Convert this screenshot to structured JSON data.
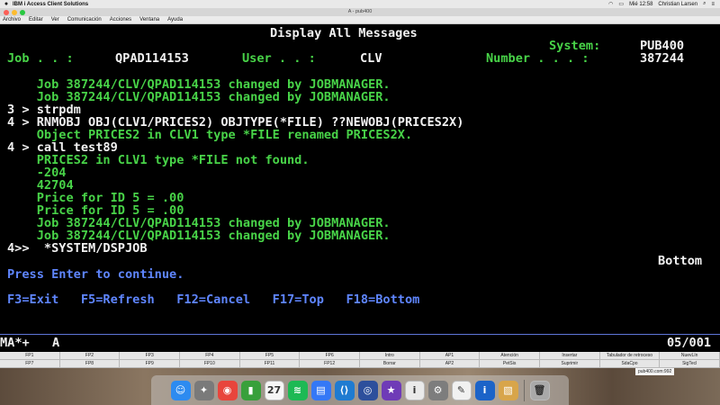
{
  "mac_menubar": {
    "app_name": "IBM i Access Client Solutions",
    "items": [
      "Archivo",
      "Editar",
      "Ver",
      "Comunicación",
      "Acciones",
      "Ventana",
      "Ayuda"
    ],
    "clock": "Mié 12:58",
    "user": "Christian Larsen"
  },
  "window": {
    "title": "A - pub400"
  },
  "terminal": {
    "screen_title": "Display All Messages",
    "system_label": "System:",
    "system_value": "PUB400",
    "job_label": "Job . . :",
    "job_value": "QPAD114153",
    "user_label": "User . . :",
    "user_value": "CLV",
    "number_label": "Number . . . :",
    "number_value": "387244",
    "messages": [
      "    Job 387244/CLV/QPAD114153 changed by JOBMANAGER.",
      "    Job 387244/CLV/QPAD114153 changed by JOBMANAGER.",
      "3 > strpdm",
      "4 > RNMOBJ OBJ(CLV1/PRICES2) OBJTYPE(*FILE) ??NEWOBJ(PRICES2X)",
      "    Object PRICES2 in CLV1 type *FILE renamed PRICES2X.",
      "4 > call test89",
      "    PRICES2 in CLV1 type *FILE not found.",
      "    -204",
      "    42704",
      "    Price for ID 5 = .00",
      "    Price for ID 5 = .00",
      "    Job 387244/CLV/QPAD114153 changed by JOBMANAGER.",
      "    Job 387244/CLV/QPAD114153 changed by JOBMANAGER.",
      "4>>  *SYSTEM/DSPJOB"
    ],
    "bottom_indicator": "Bottom",
    "prompt": "Press Enter to continue.",
    "function_keys": "F3=Exit   F5=Refresh   F12=Cancel   F17=Top   F18=Bottom"
  },
  "status_bar": {
    "mode": "MA*+",
    "session": "A",
    "cursor_pos": "05/001"
  },
  "fkey_bar": {
    "row1": [
      "FP1",
      "FP2",
      "FP3",
      "FP4",
      "FP5",
      "FP6",
      "Intro",
      "AP1",
      "Atención",
      "Insertar",
      "Tabulador de retroceso",
      "NuevLín"
    ],
    "row2": [
      "FP7",
      "FP8",
      "FP9",
      "FP10",
      "FP11",
      "FP12",
      "Borrar",
      "AP2",
      "PetSis",
      "Suprimir",
      "SdaCpo",
      "SigTecl"
    ]
  },
  "connection_label": "pub400.com:992",
  "dock": {
    "icons": [
      {
        "name": "finder-icon",
        "color": "#2d8bf0",
        "glyph": "☺"
      },
      {
        "name": "launchpad-icon",
        "color": "#7a7a7a",
        "glyph": "✦"
      },
      {
        "name": "chrome-icon",
        "color": "#e8453c",
        "glyph": "◉"
      },
      {
        "name": "numbers-icon",
        "color": "#38a03b",
        "glyph": "▮"
      },
      {
        "name": "calendar-icon",
        "color": "#f6f6f6",
        "glyph": "27"
      },
      {
        "name": "spotify-icon",
        "color": "#1db954",
        "glyph": "≋"
      },
      {
        "name": "files-icon",
        "color": "#3478f6",
        "glyph": "▤"
      },
      {
        "name": "vscode-icon",
        "color": "#1f7bd1",
        "glyph": "⟨⟩"
      },
      {
        "name": "db-icon",
        "color": "#2d4f9c",
        "glyph": "◎"
      },
      {
        "name": "imovie-icon",
        "color": "#6f3bb7",
        "glyph": "★"
      },
      {
        "name": "info-icon",
        "color": "#eaeaea",
        "glyph": "i"
      },
      {
        "name": "system-preferences-icon",
        "color": "#7d7d7d",
        "glyph": "⚙"
      },
      {
        "name": "textedit-icon",
        "color": "#f1f1f1",
        "glyph": "✎"
      },
      {
        "name": "ibm-access-icon",
        "color": "#1b63c8",
        "glyph": "i"
      },
      {
        "name": "preview-icon",
        "color": "#d8a54a",
        "glyph": "▧"
      },
      {
        "name": "trash-icon",
        "color": "#a9a9a9",
        "glyph": "🗑"
      }
    ]
  },
  "colors": {
    "terminal_green": "#48d348",
    "terminal_white": "#f1f1f1",
    "terminal_blue": "#5f86ff",
    "terminal_bg": "#000000"
  }
}
